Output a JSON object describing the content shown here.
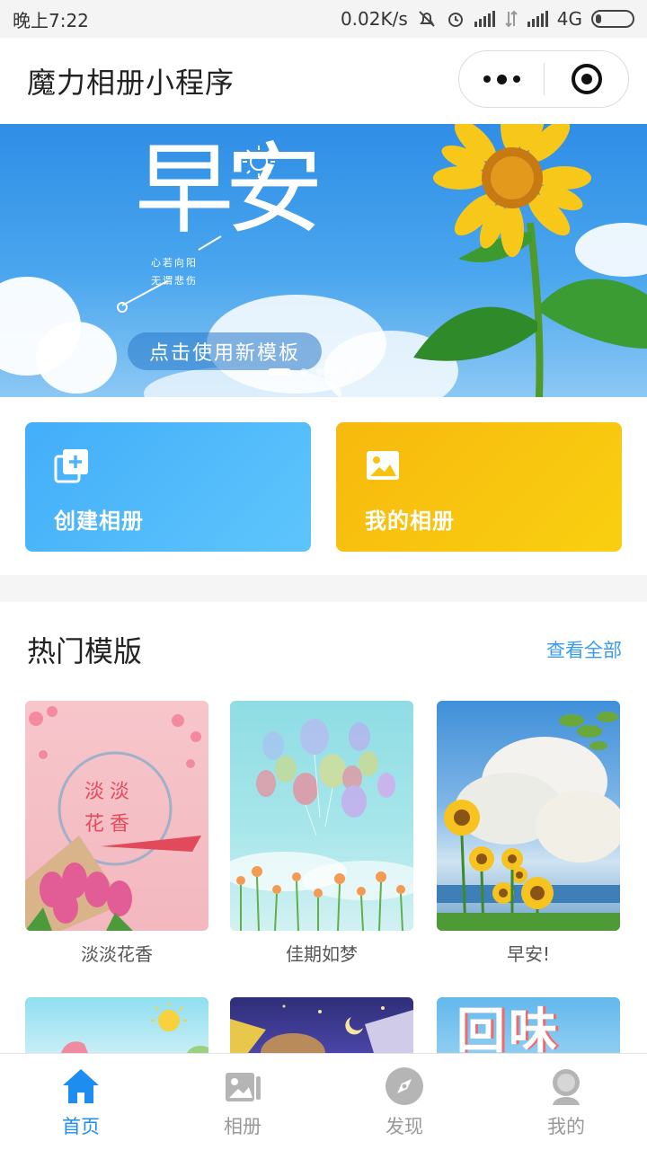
{
  "status_bar": {
    "time": "晚上7:22",
    "speed": "0.02K/s",
    "network": "4G"
  },
  "nav": {
    "title": "魔力相册小程序"
  },
  "banner": {
    "headline": "早安",
    "tagline_1": "心若向阳",
    "tagline_2": "无谓悲伤",
    "cta": "点击使用新模板",
    "slide_count": 5,
    "active_slide": 1
  },
  "quick": {
    "create_label": "创建相册",
    "mine_label": "我的相册"
  },
  "hot": {
    "title": "热门模版",
    "more": "查看全部",
    "templates": [
      {
        "name": "淡淡花香",
        "art_text": "淡淡 花香"
      },
      {
        "name": "佳期如梦"
      },
      {
        "name": "早安!"
      }
    ],
    "row2_art_text": "回味"
  },
  "tabs": [
    {
      "label": "首页",
      "icon": "home-icon",
      "active": true
    },
    {
      "label": "相册",
      "icon": "album-icon",
      "active": false
    },
    {
      "label": "发现",
      "icon": "compass-icon",
      "active": false
    },
    {
      "label": "我的",
      "icon": "user-icon",
      "active": false
    }
  ],
  "colors": {
    "accent": "#1d8ef0",
    "create_card": "#43aefa",
    "mine_card": "#f7b90e",
    "link": "#3a9bea"
  }
}
